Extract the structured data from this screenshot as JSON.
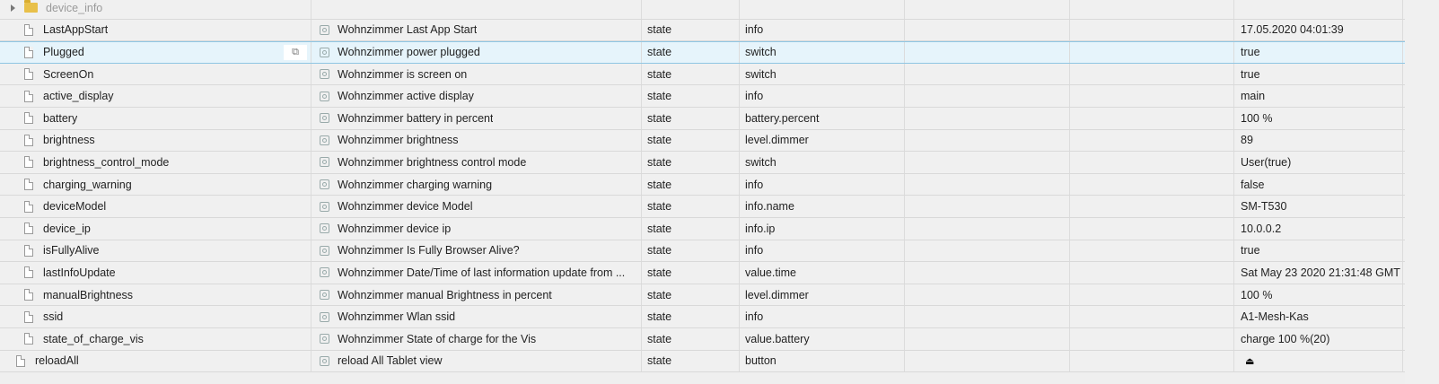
{
  "folder": {
    "label": "device_info"
  },
  "rows": [
    {
      "id": "LastAppStart",
      "name": "Wohnzimmer Last App Start",
      "type": "state",
      "role": "info",
      "value": "17.05.2020 04:01:39"
    },
    {
      "id": "Plugged",
      "name": "Wohnzimmer power plugged",
      "type": "state",
      "role": "switch",
      "value": "true",
      "selected": true
    },
    {
      "id": "ScreenOn",
      "name": "Wohnzimmer is screen on",
      "type": "state",
      "role": "switch",
      "value": "true"
    },
    {
      "id": "active_display",
      "name": "Wohnzimmer active display",
      "type": "state",
      "role": "info",
      "value": "main"
    },
    {
      "id": "battery",
      "name": "Wohnzimmer battery in percent",
      "type": "state",
      "role": "battery.percent",
      "value": "100 %"
    },
    {
      "id": "brightness",
      "name": "Wohnzimmer brightness",
      "type": "state",
      "role": "level.dimmer",
      "value": "89"
    },
    {
      "id": "brightness_control_mode",
      "name": "Wohnzimmer brightness control mode",
      "type": "state",
      "role": "switch",
      "value": "User(true)"
    },
    {
      "id": "charging_warning",
      "name": "Wohnzimmer charging warning",
      "type": "state",
      "role": "info",
      "value": "false"
    },
    {
      "id": "deviceModel",
      "name": "Wohnzimmer device Model",
      "type": "state",
      "role": "info.name",
      "value": "SM-T530"
    },
    {
      "id": "device_ip",
      "name": "Wohnzimmer device ip",
      "type": "state",
      "role": "info.ip",
      "value": "10.0.0.2"
    },
    {
      "id": "isFullyAlive",
      "name": "Wohnzimmer Is Fully Browser Alive?",
      "type": "state",
      "role": "info",
      "value": "true"
    },
    {
      "id": "lastInfoUpdate",
      "name": "Wohnzimmer Date/Time of last information update from ...",
      "type": "state",
      "role": "value.time",
      "value": "Sat May 23 2020 21:31:48 GMT"
    },
    {
      "id": "manualBrightness",
      "name": "Wohnzimmer manual Brightness in percent",
      "type": "state",
      "role": "level.dimmer",
      "value": "100 %"
    },
    {
      "id": "ssid",
      "name": "Wohnzimmer Wlan ssid",
      "type": "state",
      "role": "info",
      "value": "A1-Mesh-Kas"
    },
    {
      "id": "state_of_charge_vis",
      "name": "Wohnzimmer State of charge for the Vis",
      "type": "state",
      "role": "value.battery",
      "value": "charge 100 %(20)"
    },
    {
      "id": "reloadAll",
      "name": "reload All Tablet view",
      "type": "state",
      "role": "button",
      "value": "",
      "is_button": true,
      "button_icon": "eject-icon"
    }
  ]
}
